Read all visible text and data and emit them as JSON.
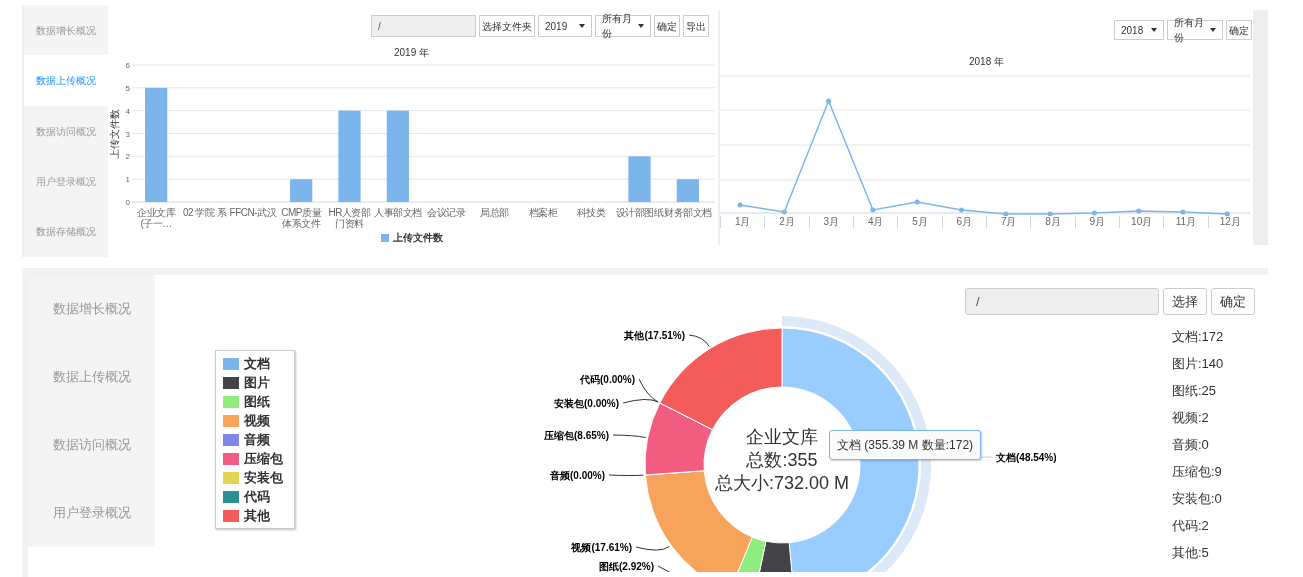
{
  "upload_panel": {
    "sidebar": {
      "items": [
        {
          "label": "数据增长概况",
          "selected": false
        },
        {
          "label": "数据上传概况",
          "selected": true
        },
        {
          "label": "数据访问概况",
          "selected": false
        },
        {
          "label": "用户登录概况",
          "selected": false
        },
        {
          "label": "数据存储概况",
          "selected": false
        }
      ]
    },
    "toolbar": {
      "path_field": {
        "value": "/"
      },
      "folder_button": "选择文件夹",
      "year_select": "2019",
      "month_select": "所有月份",
      "confirm_button": "确定",
      "export_button": "导出"
    },
    "chart": {
      "chart_data": {
        "type": "bar",
        "title": "2019 年",
        "ylabel": "上传文件数",
        "categories": [
          "企业文库(子一…",
          "02 学院 系",
          "FFCN-武汉",
          "CMP质量体系文件",
          "HR人资部门资料",
          "人事部文档",
          "会议记录",
          "局总部",
          "档案柜",
          "科技类",
          "设计部图纸",
          "财务部文档"
        ],
        "series": [
          {
            "name": "上传文件数",
            "color": "#7cb5ec",
            "values": [
              5,
              0,
              0,
              1,
              4,
              4,
              0,
              0,
              0,
              0,
              2,
              1
            ]
          }
        ],
        "ylim": [
          0,
          6
        ],
        "yticks": [
          0,
          1,
          2,
          3,
          4,
          5,
          6
        ],
        "grid": true
      }
    }
  },
  "monthly_panel": {
    "toolbar": {
      "year_select": "2018",
      "month_select": "所有月份",
      "confirm_button": "确定"
    },
    "chart": {
      "title": "2018 年",
      "x_labels": [
        "1月",
        "2月",
        "3月",
        "4月",
        "5月",
        "6月",
        "7月",
        "8月",
        "9月",
        "10月",
        "11月",
        "12月"
      ]
    }
  },
  "storage_panel": {
    "sidebar": {
      "items": [
        {
          "label": "数据增长概况",
          "selected": false
        },
        {
          "label": "数据上传概况",
          "selected": false
        },
        {
          "label": "数据访问概况",
          "selected": false
        },
        {
          "label": "用户登录概况",
          "selected": false
        }
      ]
    },
    "toolbar": {
      "path_field": {
        "value": "/"
      },
      "select_button": "选择",
      "confirm_button": "确定"
    },
    "legend": [
      {
        "color": "#7cb5ec"
      },
      {
        "color": "#434348"
      },
      {
        "color": "#90ed7d"
      },
      {
        "color": "#f7a35c"
      },
      {
        "color": "#8085e9"
      },
      {
        "color": "#f15c80"
      },
      {
        "color": "#e4d354"
      },
      {
        "color": "#2b908f"
      },
      {
        "color": "#f45b5b"
      }
    ],
    "donut": {
      "chart_data": {
        "type": "donut",
        "categories": [
          "文档",
          "图片",
          "图纸",
          "视频",
          "音频",
          "压缩包",
          "安装包",
          "代码",
          "其他"
        ],
        "values": [
          48.54,
          4.77,
          2.92,
          17.61,
          0,
          8.65,
          0,
          0,
          17.51
        ],
        "value_labels": [
          "文档(48.54%)",
          null,
          "图纸(2.92%)",
          "视频(17.61%)",
          "音频(0.00%)",
          "压缩包(8.65%)",
          "安装包(0.00%)",
          "代码(0.00%)",
          "其他(17.51%)"
        ]
      },
      "center_text": [
        "企业文库",
        "总数:355",
        "总大小:732.00 M"
      ],
      "tooltip": {
        "text": "文档 (355.39 M 数量:172)"
      }
    },
    "counts": [
      "文档:172",
      "图片:140",
      "图纸:25",
      "视频:2",
      "音频:0",
      "压缩包:9",
      "安装包:0",
      "代码:2",
      "其他:5"
    ]
  }
}
